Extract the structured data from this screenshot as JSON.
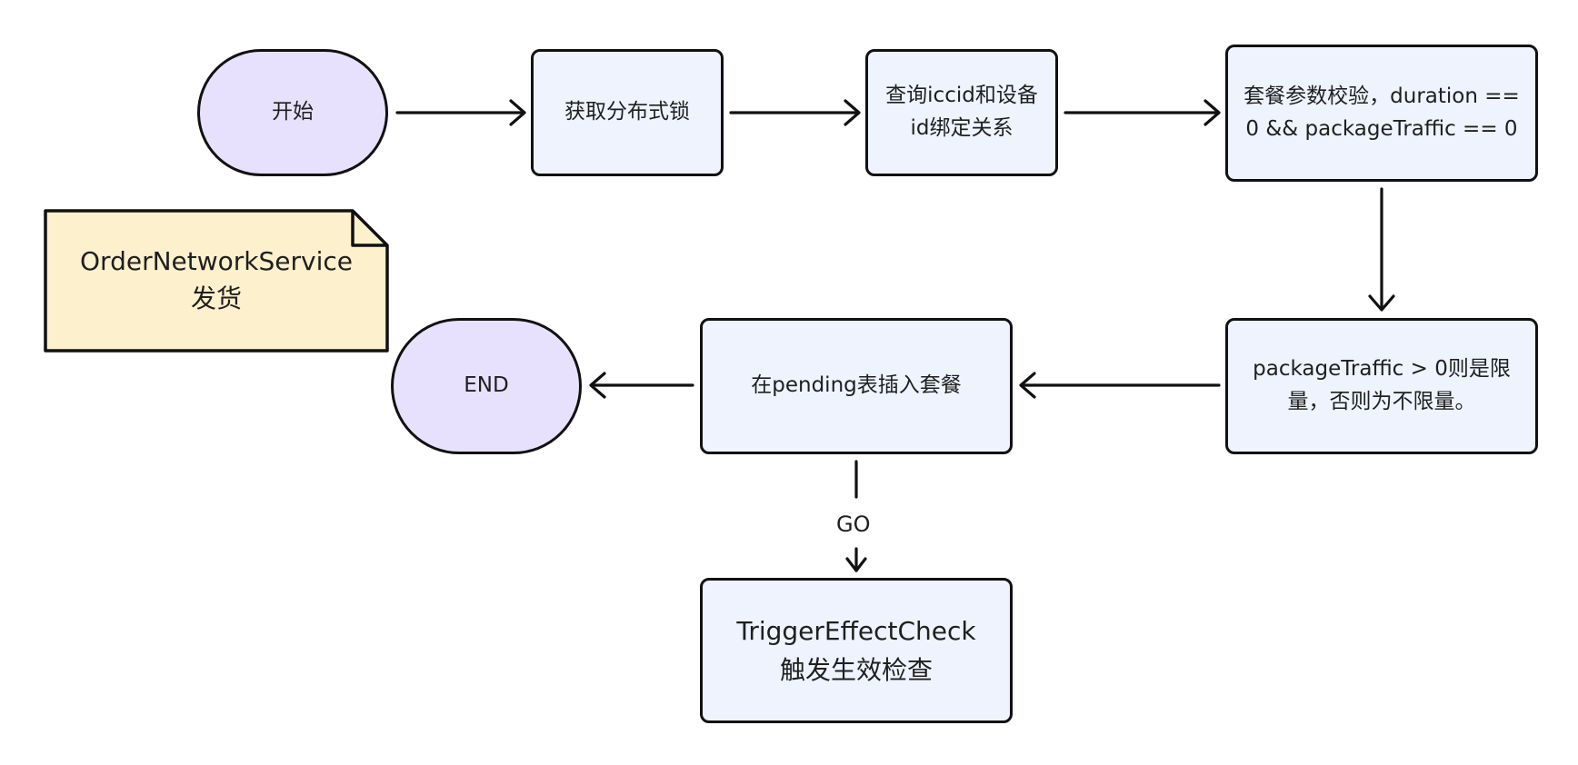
{
  "note": {
    "text": "OrderNetworkService\n发货"
  },
  "nodes": {
    "start": "开始",
    "lock": "获取分布式锁",
    "query": "查询iccid和设备\nid绑定关系",
    "validate": "套餐参数校验，duration ==\n0 && packageTraffic == 0",
    "traffic": "packageTraffic > 0则是限\n量，否则为不限量。",
    "insert": "在pending表插入套餐",
    "end": "END",
    "trigger": "TriggerEffectCheck\n触发生效检查"
  },
  "edges": {
    "go_label": "GO"
  },
  "colors": {
    "terminal_fill": "#e8e1fd",
    "process_fill": "#eef3fd",
    "note_fill": "#fdf0cc",
    "stroke": "#111111"
  }
}
